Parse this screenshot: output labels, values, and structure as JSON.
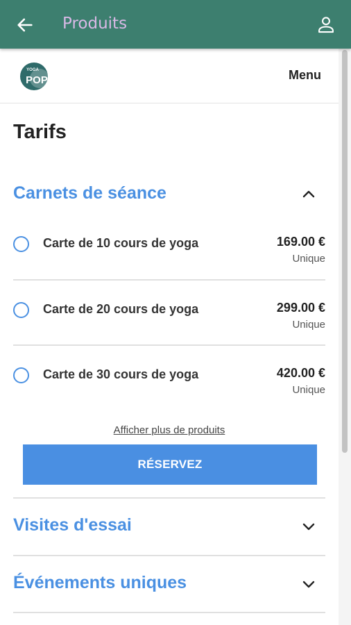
{
  "appbar": {
    "title": "Produits",
    "back_icon": "arrow-left-icon",
    "user_icon": "user-icon",
    "background": "#3d7f6f"
  },
  "site_header": {
    "logo_text_top": "YOGA",
    "logo_text_bottom": "POP",
    "menu_label": "Menu"
  },
  "page": {
    "title": "Tarifs"
  },
  "sections": [
    {
      "label": "Carnets de séance",
      "expanded": true,
      "products": [
        {
          "name": "Carte de 10 cours de yoga",
          "price": "169.00 €",
          "frequency": "Unique"
        },
        {
          "name": "Carte de 20 cours de yoga",
          "price": "299.00 €",
          "frequency": "Unique"
        },
        {
          "name": "Carte de 30 cours de yoga",
          "price": "420.00 €",
          "frequency": "Unique"
        }
      ],
      "more_link": "Afficher plus de produits",
      "cta": "RÉSERVEZ"
    },
    {
      "label": "Visites d'essai",
      "expanded": false
    },
    {
      "label": "Événements uniques",
      "expanded": false
    }
  ],
  "colors": {
    "accent": "#4a90e2",
    "title_text": "#d9b9e6"
  }
}
